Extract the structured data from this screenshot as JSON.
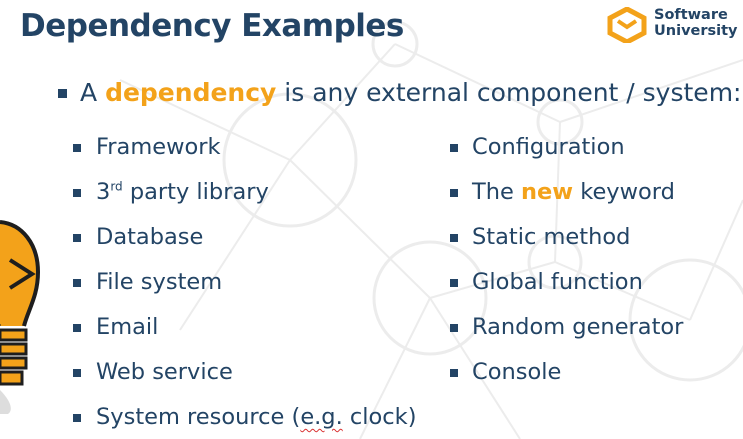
{
  "title": "Dependency Examples",
  "logo": {
    "line1": "Software",
    "line2": "University",
    "colors": {
      "orange": "#f3a21a",
      "navy": "#234465"
    }
  },
  "intro": {
    "prefix": "A ",
    "highlight": "dependency",
    "suffix": " is any external component / system:"
  },
  "left_items": [
    {
      "label": "Framework"
    },
    {
      "label_pre": "3",
      "label_sup": "rd",
      "label_post": " party library"
    },
    {
      "label": "Database"
    },
    {
      "label": "File system"
    },
    {
      "label": "Email"
    },
    {
      "label": "Web service"
    },
    {
      "label_pre": "System resource (",
      "label_squiggle": "e.g.",
      "label_post": " clock)"
    }
  ],
  "right_items": [
    {
      "label": "Configuration"
    },
    {
      "label_pre": "The ",
      "label_highlight": "new",
      "label_post": " keyword"
    },
    {
      "label": "Static method"
    },
    {
      "label": "Global function"
    },
    {
      "label": "Random generator"
    },
    {
      "label": "Console"
    }
  ],
  "colors": {
    "text": "#234465",
    "accent": "#f3a21a",
    "background_lines": "#e9e9e9"
  },
  "icons": [
    "lightbulb-icon",
    "software-university-logo-icon"
  ]
}
